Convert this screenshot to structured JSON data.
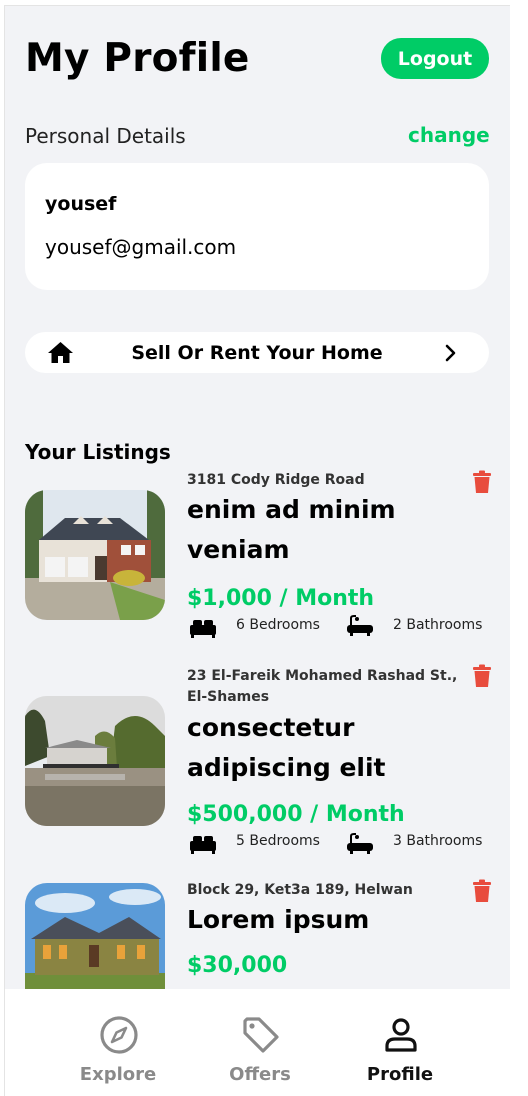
{
  "header": {
    "title": "My Profile",
    "logout_label": "Logout"
  },
  "personal_details": {
    "section_label": "Personal Details",
    "change_label": "change",
    "name": "yousef",
    "email": "yousef@gmail.com"
  },
  "sell_button": {
    "label": "Sell Or Rent Your Home",
    "icon": "home-icon",
    "chevron": "chevron-right-icon"
  },
  "listings": {
    "title": "Your Listings",
    "items": [
      {
        "address": "3181 Cody Ridge Road",
        "title": "enim ad minim veniam",
        "price": "$1,000 / Month",
        "bedrooms": "6 Bedrooms",
        "bathrooms": "2 Bathrooms"
      },
      {
        "address": "23 El-Fareik Mohamed Rashad St., El-Shames",
        "title": "consectetur adipiscing elit",
        "price": "$500,000 / Month",
        "bedrooms": "5 Bedrooms",
        "bathrooms": "3 Bathrooms"
      },
      {
        "address": "Block 29, Ket3a 189, Helwan",
        "title": "Lorem ipsum",
        "price": "$30,000"
      }
    ]
  },
  "tab_bar": {
    "tabs": [
      {
        "label": "Explore",
        "icon": "compass-icon",
        "active": false
      },
      {
        "label": "Offers",
        "icon": "tag-icon",
        "active": false
      },
      {
        "label": "Profile",
        "icon": "person-icon",
        "active": true
      }
    ]
  },
  "colors": {
    "accent": "#00cc66",
    "danger": "#e84c3d",
    "inactive": "#8a8a8a",
    "background": "#f2f3f6"
  }
}
